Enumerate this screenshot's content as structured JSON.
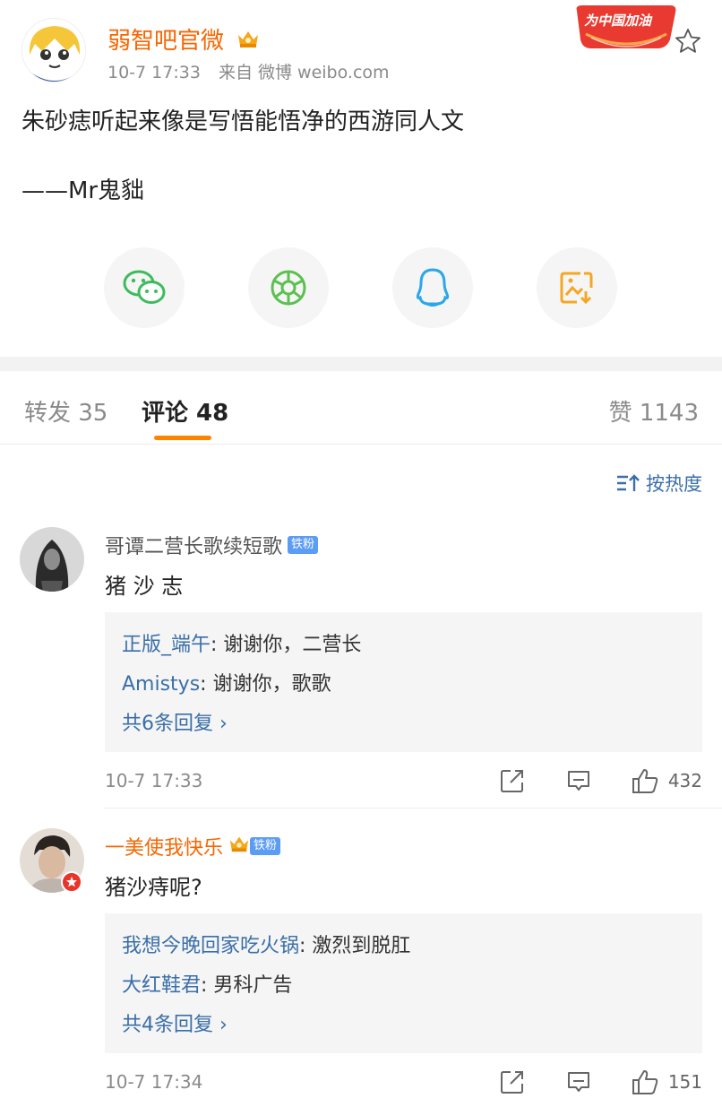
{
  "post": {
    "author": "弱智吧官微",
    "time": "10-7 17:33",
    "source": "来自 微博 weibo.com",
    "promo_badge": "为中国加油",
    "content": "朱砂痣听起来像是写悟能悟净的西游同人文",
    "signature": "——Mr鬼貀",
    "share_icons": [
      "wechat-icon",
      "moments-icon",
      "qq-icon",
      "save-image-icon"
    ]
  },
  "tabs": {
    "repost": "转发 35",
    "comment": "评论 48",
    "like": "赞 1143"
  },
  "sort": {
    "label": "按热度",
    "icon": "sort-icon"
  },
  "comments": [
    {
      "name": "哥谭二营长歌续短歌",
      "badge": "铁粉",
      "text": "猪 沙 志",
      "replies": [
        {
          "user": "正版_端午",
          "text": ": 谢谢你，二营长"
        },
        {
          "user": "Amistys",
          "text": ": 谢谢你，歌歌"
        }
      ],
      "more": "共6条回复 ›",
      "time": "10-7 17:33",
      "likes": "432"
    },
    {
      "name": "一美使我快乐",
      "badge": "铁粉",
      "text": "猪沙痔呢?",
      "replies": [
        {
          "user": "我想今晚回家吃火锅",
          "text": ": 激烈到脱肛"
        },
        {
          "user": "大红鞋君",
          "text": ": 男科广告"
        }
      ],
      "more": "共4条回复 ›",
      "time": "10-7 17:34",
      "likes": "151"
    }
  ],
  "colors": {
    "accent_orange": "#ff8200",
    "link_blue": "#3a6fa8",
    "author_orange": "#f76600"
  }
}
